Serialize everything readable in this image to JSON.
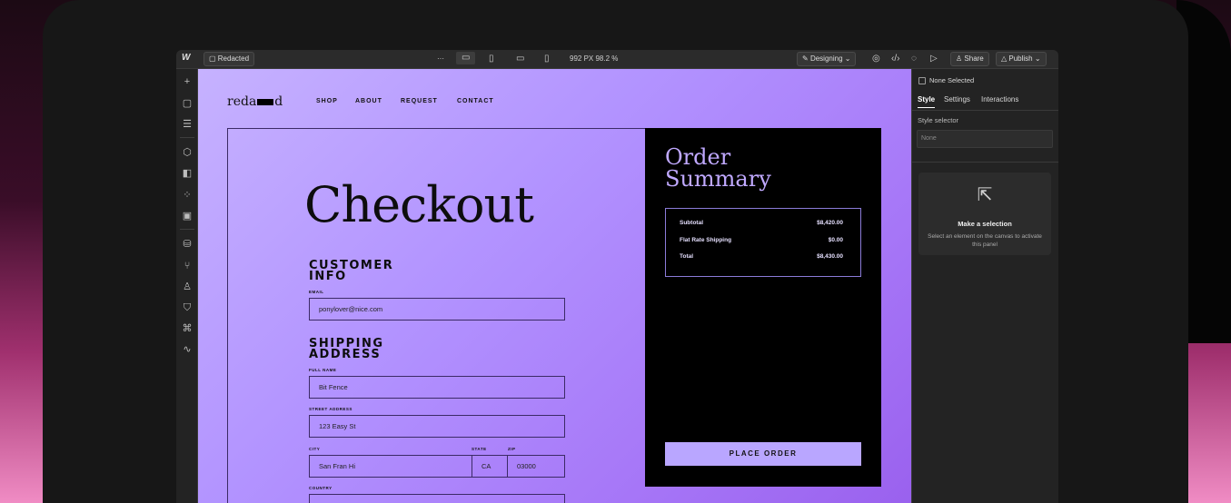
{
  "app": {
    "project": "Redacted",
    "more": "···",
    "zoom": "992 PX  98.2 %",
    "mode": "Designing",
    "share": "Share",
    "publish": "Publish"
  },
  "site": {
    "logo_a": "reda",
    "logo_b": "d",
    "nav": [
      "SHOP",
      "ABOUT",
      "REQUEST",
      "CONTACT"
    ]
  },
  "checkout": {
    "title": "Checkout",
    "customer_h1": "CUSTOMER",
    "customer_h2": "INFO",
    "email_label": "EMAIL",
    "email": "ponylover@nice.com",
    "shipping_h1": "SHIPPING",
    "shipping_h2": "ADDRESS",
    "name_label": "FULL NAME",
    "name": "Bit Fence",
    "street_label": "STREET ADDRESS",
    "street": "123 Easy St",
    "city_label": "CITY",
    "city": "San Fran Hi",
    "state_label": "STATE",
    "state": "CA",
    "zip_label": "ZIP",
    "zip": "03000",
    "country_label": "COUNTRY"
  },
  "order": {
    "title1": "Order",
    "title2": "Summary",
    "rows": [
      {
        "label": "Subtotal",
        "value": "$8,420.00"
      },
      {
        "label": "Flat Rate Shipping",
        "value": "$0.00"
      },
      {
        "label": "Total",
        "value": "$8,430.00"
      }
    ],
    "button": "PLACE ORDER"
  },
  "panel": {
    "none_selected": "None Selected",
    "tabs": [
      "Style",
      "Settings",
      "Interactions"
    ],
    "selector_label": "Style selector",
    "selector_value": "None",
    "card_title": "Make a selection",
    "card_text": "Select an element on the canvas to activate this panel"
  },
  "colors": {
    "accent": "#b9a6ff",
    "canvas": "#b293ff",
    "frame": "#171717"
  }
}
